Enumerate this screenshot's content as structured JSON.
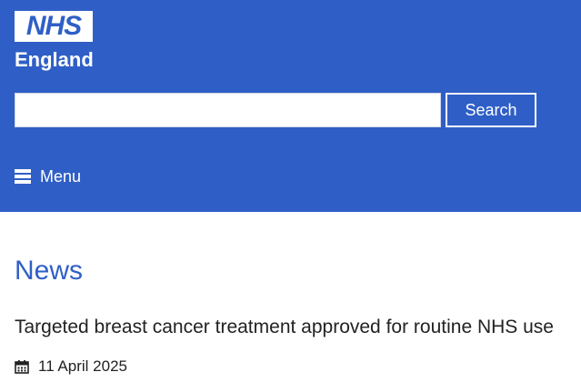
{
  "header": {
    "logo": {
      "mark": "NHS",
      "region": "England"
    },
    "search": {
      "value": "",
      "placeholder": "",
      "button_label": "Search"
    },
    "menu": {
      "label": "Menu",
      "icon": "hamburger-icon"
    }
  },
  "main": {
    "title": "News",
    "articles": [
      {
        "title": "Targeted breast cancer treatment approved for routine NHS use",
        "date": "11 April 2025",
        "date_icon": "calendar-icon"
      }
    ]
  },
  "colors": {
    "brand_blue": "#2f5fc6",
    "text": "#222222",
    "white": "#ffffff"
  }
}
